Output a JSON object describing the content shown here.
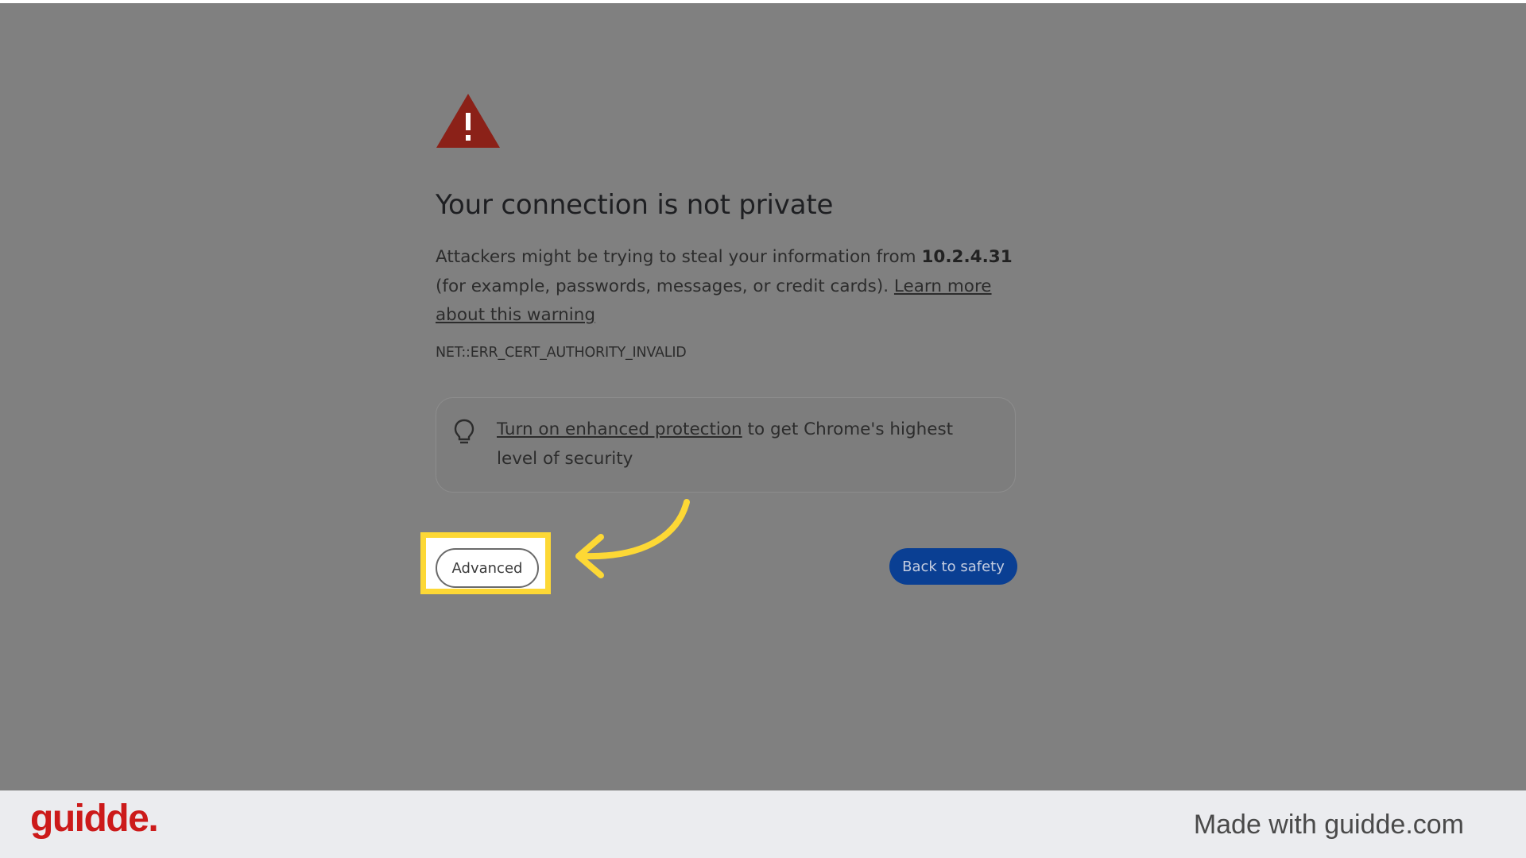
{
  "page": {
    "title": "Your connection is not private",
    "description": {
      "prefix": "Attackers might be trying to steal your information from ",
      "host": "10.2.4.31",
      "suffix": " (for example, passwords, messages, or credit cards). ",
      "learn_more_link": "Learn more about this warning"
    },
    "error_code": "NET::ERR_CERT_AUTHORITY_INVALID",
    "tip": {
      "link": "Turn on enhanced protection",
      "text": " to get Chrome's highest level of security"
    },
    "buttons": {
      "advanced": "Advanced",
      "back_to_safety": "Back to safety"
    }
  },
  "icons": {
    "warning": "warning-triangle-icon",
    "tip": "lightbulb-icon",
    "annotation": "curved-arrow-icon"
  },
  "footer": {
    "brand": "guidde.",
    "made_with": "Made with guidde.com"
  },
  "colors": {
    "overlay": "#808080",
    "warning_red": "#8b2118",
    "primary_button": "#0a3f93",
    "highlight": "#fdd835",
    "brand_red": "#cc1a1a"
  }
}
